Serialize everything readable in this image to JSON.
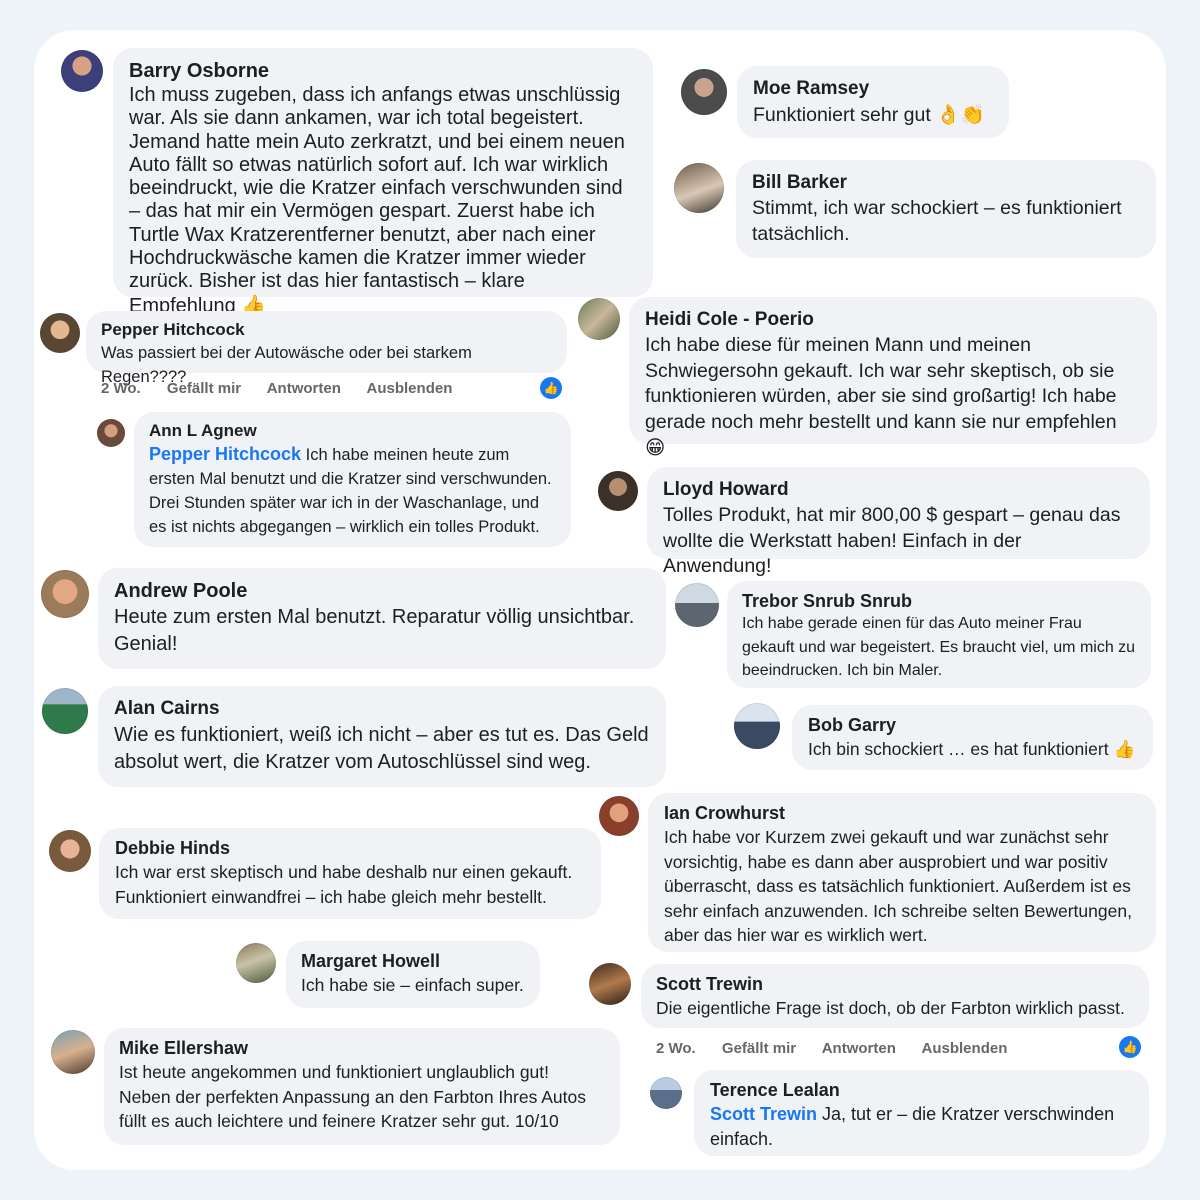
{
  "comments": [
    {
      "name": "Barry Osborne",
      "text": "Ich muss zugeben, dass ich anfangs etwas unschlüssig war. Als sie dann ankamen, war ich total begeistert. Jemand hatte mein Auto zerkratzt, und bei einem neuen Auto fällt so etwas natürlich sofort auf. Ich war wirklich beeindruckt, wie die Kratzer einfach verschwunden sind – das hat mir ein Vermögen gespart. Zuerst habe ich Turtle Wax Kratzerentferner benutzt, aber nach einer Hochdruckwäsche kamen die Kratzer immer wieder zurück. Bisher ist das hier fantastisch – klare Empfehlung",
      "emoji": "👍"
    },
    {
      "name": "Moe Ramsey",
      "text": "Funktioniert sehr gut",
      "emoji": "👌👏"
    },
    {
      "name": "Bill Barker",
      "text": "Stimmt, ich war schockiert – es funktioniert tatsächlich."
    },
    {
      "name": "Pepper Hitchcock",
      "text": "Was passiert bei der Autowäsche oder bei starkem Regen????"
    },
    {
      "name": "Heidi Cole - Poerio",
      "text": "Ich habe diese für meinen Mann und meinen Schwiegersohn gekauft. Ich war sehr skeptisch, ob sie funktionieren würden, aber sie sind großartig! Ich habe gerade noch mehr bestellt und kann sie nur empfehlen",
      "emoji": "😁"
    },
    {
      "name": "Ann L Agnew",
      "mention": "Pepper Hitchcock",
      "text": "Ich habe meinen heute zum ersten Mal benutzt und die Kratzer sind verschwunden. Drei Stunden später war ich in der Waschanlage, und es ist nichts abgegangen – wirklich ein tolles Produkt."
    },
    {
      "name": "Lloyd Howard",
      "text": "Tolles Produkt, hat mir 800,00 $ gespart – genau das wollte die Werkstatt haben! Einfach in der Anwendung!"
    },
    {
      "name": "Andrew Poole",
      "text": "Heute zum ersten Mal benutzt. Reparatur völlig unsichtbar. Genial!"
    },
    {
      "name": "Trebor Snrub Snrub",
      "text": "Ich habe gerade einen für das Auto meiner Frau gekauft und war begeistert. Es braucht viel, um mich zu beeindrucken. Ich bin Maler."
    },
    {
      "name": "Alan Cairns",
      "text": "Wie es funktioniert, weiß ich nicht – aber es tut es. Das Geld absolut wert, die Kratzer vom Autoschlüssel sind weg."
    },
    {
      "name": "Bob Garry",
      "text": "Ich bin schockiert … es hat funktioniert",
      "emoji": "👍"
    },
    {
      "name": "Ian Crowhurst",
      "text": "Ich habe vor Kurzem zwei gekauft und war zunächst sehr vorsichtig, habe es dann aber ausprobiert und war positiv überrascht, dass es tatsächlich funktioniert. Außerdem ist es sehr einfach anzuwenden. Ich schreibe selten Bewertungen, aber das hier war es wirklich wert."
    },
    {
      "name": "Debbie Hinds",
      "text": "Ich war erst skeptisch und habe deshalb nur einen gekauft. Funktioniert einwandfrei – ich habe gleich mehr bestellt."
    },
    {
      "name": "Margaret Howell",
      "text": "Ich habe sie – einfach super."
    },
    {
      "name": "Scott Trewin",
      "text": "Die eigentliche Frage ist doch, ob der Farbton wirklich passt."
    },
    {
      "name": "Mike Ellershaw",
      "text": "Ist heute angekommen und funktioniert unglaublich gut! Neben der perfekten Anpassung an den Farbton Ihres Autos füllt es auch leichtere und feinere Kratzer sehr gut. 10/10"
    },
    {
      "name": "Terence Lealan",
      "mention": "Scott Trewin",
      "text": "Ja, tut er – die Kratzer verschwinden einfach."
    }
  ],
  "actions": {
    "time": "2 Wo.",
    "like": "Gefällt mir",
    "reply": "Antworten",
    "hide": "Ausblenden"
  },
  "icons": {
    "like_badge": "thumbs-up-icon"
  },
  "colors": {
    "bubble": "#f0f2f5",
    "mention": "#1877f2",
    "like_badge": "#1877f2",
    "meta": "#65676b"
  }
}
